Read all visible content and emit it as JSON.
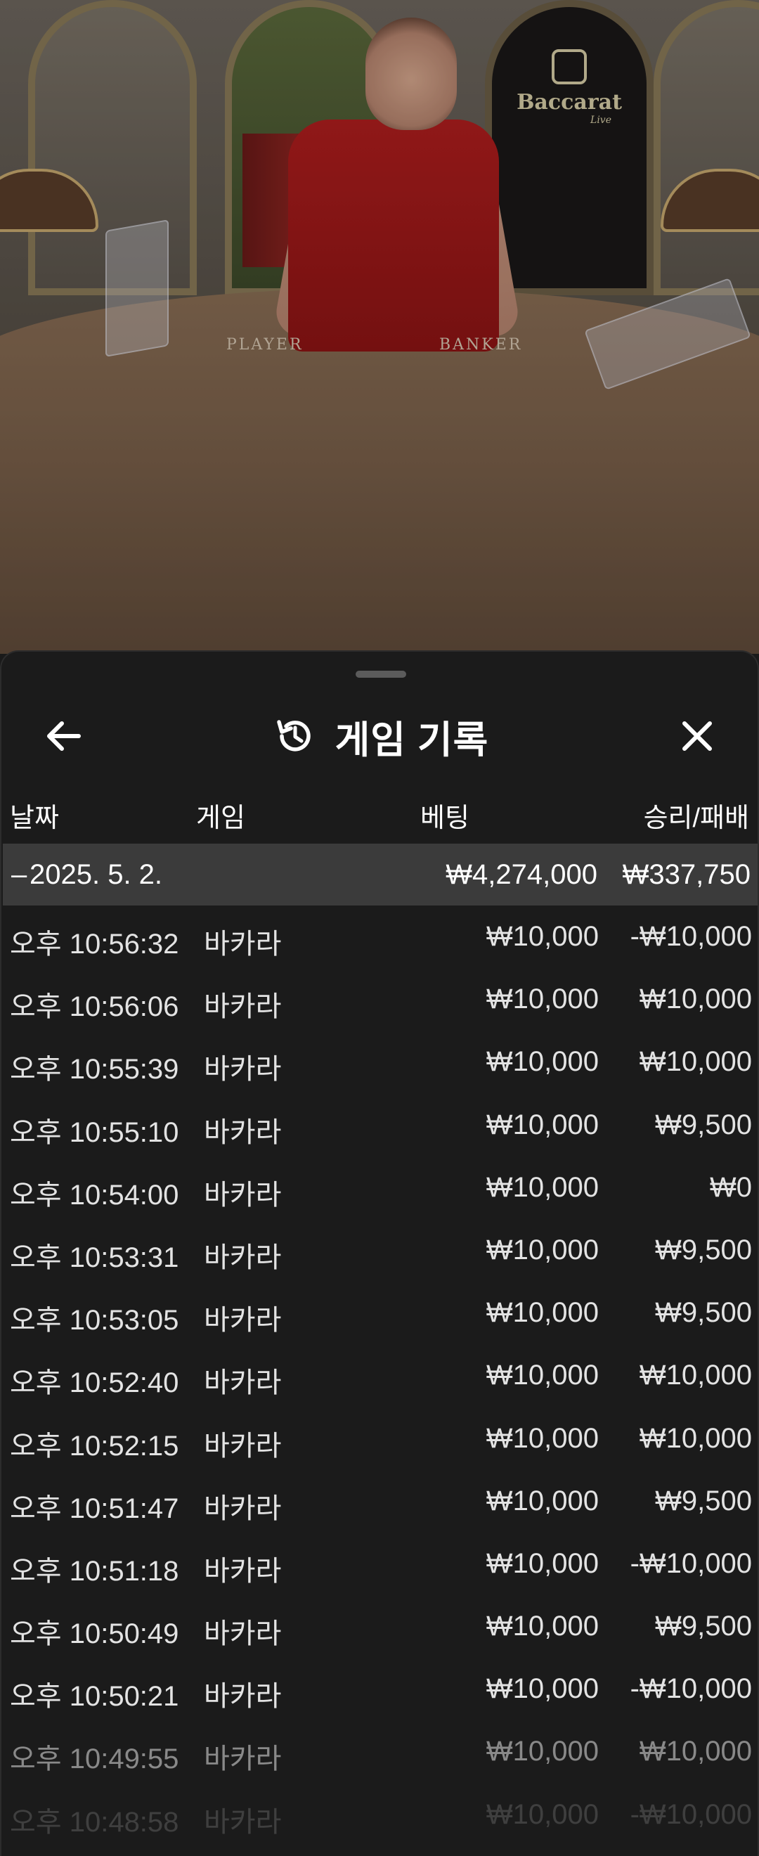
{
  "video": {
    "logo_text": "Baccarat",
    "logo_sub": "Live",
    "table_left_label": "PLAYER",
    "table_right_label": "BANKER"
  },
  "panel": {
    "title": "게임 기록",
    "back_icon": "arrow-left-icon",
    "history_icon": "history-icon",
    "close_icon": "close-icon"
  },
  "columns": {
    "date": "날짜",
    "game": "게임",
    "bet": "베팅",
    "win_loss": "승리/패배"
  },
  "summary": {
    "toggle": "–",
    "date": "2025. 5. 2.",
    "bet_total": "₩4,274,000",
    "win_total": "₩337,750"
  },
  "rows": [
    {
      "time": "오후 10:56:32",
      "game": "바카라",
      "bet": "₩10,000",
      "win": "-₩10,000"
    },
    {
      "time": "오후 10:56:06",
      "game": "바카라",
      "bet": "₩10,000",
      "win": "₩10,000"
    },
    {
      "time": "오후 10:55:39",
      "game": "바카라",
      "bet": "₩10,000",
      "win": "₩10,000"
    },
    {
      "time": "오후 10:55:10",
      "game": "바카라",
      "bet": "₩10,000",
      "win": "₩9,500"
    },
    {
      "time": "오후 10:54:00",
      "game": "바카라",
      "bet": "₩10,000",
      "win": "₩0"
    },
    {
      "time": "오후 10:53:31",
      "game": "바카라",
      "bet": "₩10,000",
      "win": "₩9,500"
    },
    {
      "time": "오후 10:53:05",
      "game": "바카라",
      "bet": "₩10,000",
      "win": "₩9,500"
    },
    {
      "time": "오후 10:52:40",
      "game": "바카라",
      "bet": "₩10,000",
      "win": "₩10,000"
    },
    {
      "time": "오후 10:52:15",
      "game": "바카라",
      "bet": "₩10,000",
      "win": "₩10,000"
    },
    {
      "time": "오후 10:51:47",
      "game": "바카라",
      "bet": "₩10,000",
      "win": "₩9,500"
    },
    {
      "time": "오후 10:51:18",
      "game": "바카라",
      "bet": "₩10,000",
      "win": "-₩10,000"
    },
    {
      "time": "오후 10:50:49",
      "game": "바카라",
      "bet": "₩10,000",
      "win": "₩9,500"
    },
    {
      "time": "오후 10:50:21",
      "game": "바카라",
      "bet": "₩10,000",
      "win": "-₩10,000"
    },
    {
      "time": "오후 10:49:55",
      "game": "바카라",
      "bet": "₩10,000",
      "win": "₩10,000"
    },
    {
      "time": "오후 10:48:58",
      "game": "바카라",
      "bet": "₩10,000",
      "win": "-₩10,000"
    }
  ]
}
